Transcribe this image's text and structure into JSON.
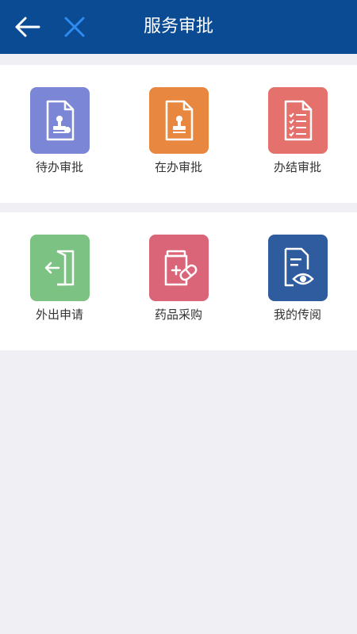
{
  "header": {
    "title": "服务审批",
    "background": "#0a4b94",
    "back_icon": "arrow-left-icon",
    "close_icon": "close-icon",
    "close_icon_color": "#2d8cf0"
  },
  "approval_section": {
    "items": [
      {
        "label": "待办审批",
        "icon": "document-stamp-icon",
        "color": "#7b86d6"
      },
      {
        "label": "在办审批",
        "icon": "document-stamp-icon",
        "color": "#e8873f"
      },
      {
        "label": "办结审批",
        "icon": "checklist-document-icon",
        "color": "#e4716b"
      }
    ]
  },
  "services_section": {
    "items": [
      {
        "label": "外出申请",
        "icon": "exit-door-icon",
        "color": "#7cc383"
      },
      {
        "label": "药品采购",
        "icon": "medicine-icon",
        "color": "#db6578"
      },
      {
        "label": "我的传阅",
        "icon": "document-view-icon",
        "color": "#2f5b9f"
      }
    ]
  }
}
